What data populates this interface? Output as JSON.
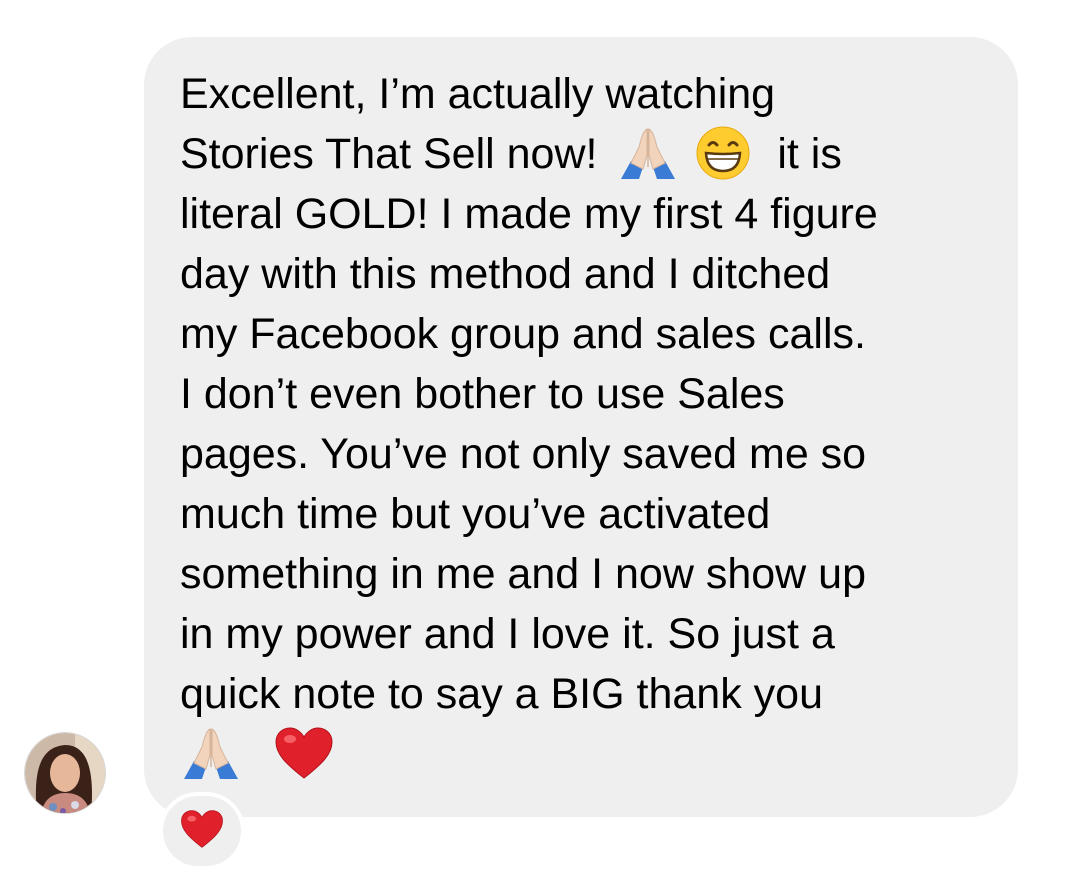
{
  "message": {
    "lines": [
      "Excellent, I’m actually watching",
      "Stories That Sell now!",
      "it is",
      "literal GOLD! I made my first 4 figure",
      "day with this method and I ditched",
      "my Facebook group and sales calls.",
      "I don’t even bother to use Sales",
      "pages. You’ve not only saved me so",
      "much time but you’ve activated",
      "something in me and I now show up",
      "in my power and I love it. So just a",
      "quick note to say a BIG thank you"
    ],
    "emojis": {
      "line2": [
        "folded-hands",
        "grinning-face"
      ],
      "last_line": [
        "folded-hands",
        "red-heart"
      ]
    }
  },
  "reaction": {
    "emoji": "red-heart"
  },
  "sender": {
    "avatar": "profile-photo"
  },
  "colors": {
    "bubble": "#efefef",
    "text": "#000000",
    "heart": "#e0202a"
  }
}
